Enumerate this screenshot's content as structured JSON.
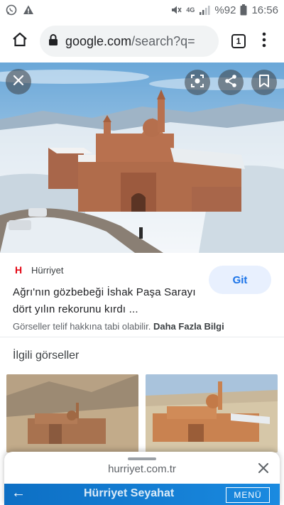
{
  "status_bar": {
    "network": "4G",
    "battery": "%92",
    "time": "16:56"
  },
  "toolbar": {
    "url_host": "google.com",
    "url_path": "/search?q=",
    "tab_count": "1"
  },
  "result": {
    "source_name": "Hürriyet",
    "source_logo_letter": "H",
    "title": "Ağrı'nın gözbebeği İshak Paşa Sarayı dört yılın rekorunu kırdı ...",
    "visit_label": "Git",
    "copyright_text": "Görseller telif hakkına tabi olabilir.",
    "more_info_label": "Daha Fazla Bilgi"
  },
  "related": {
    "heading": "İlgili görseller"
  },
  "sheet": {
    "url": "hurriyet.com.tr",
    "site_brand": "Hürriyet Seyahat",
    "site_menu": "MENÜ",
    "back_arrow": "←"
  },
  "icons": {
    "whatsapp": "whatsapp-icon",
    "warning": "warning-icon",
    "mute": "mute-icon",
    "signal": "signal-icon",
    "battery": "battery-icon",
    "home": "home-icon",
    "lock": "lock-icon",
    "tabs": "tabs-icon",
    "more": "more-vert-icon",
    "close": "close-icon",
    "lens": "lens-icon",
    "share": "share-icon",
    "bookmark": "bookmark-icon"
  },
  "colors": {
    "accent": "#1a73e8",
    "accent_bg": "#e8f0fe",
    "brand_red": "#e30613",
    "site_blue": "#0d6fc4"
  }
}
